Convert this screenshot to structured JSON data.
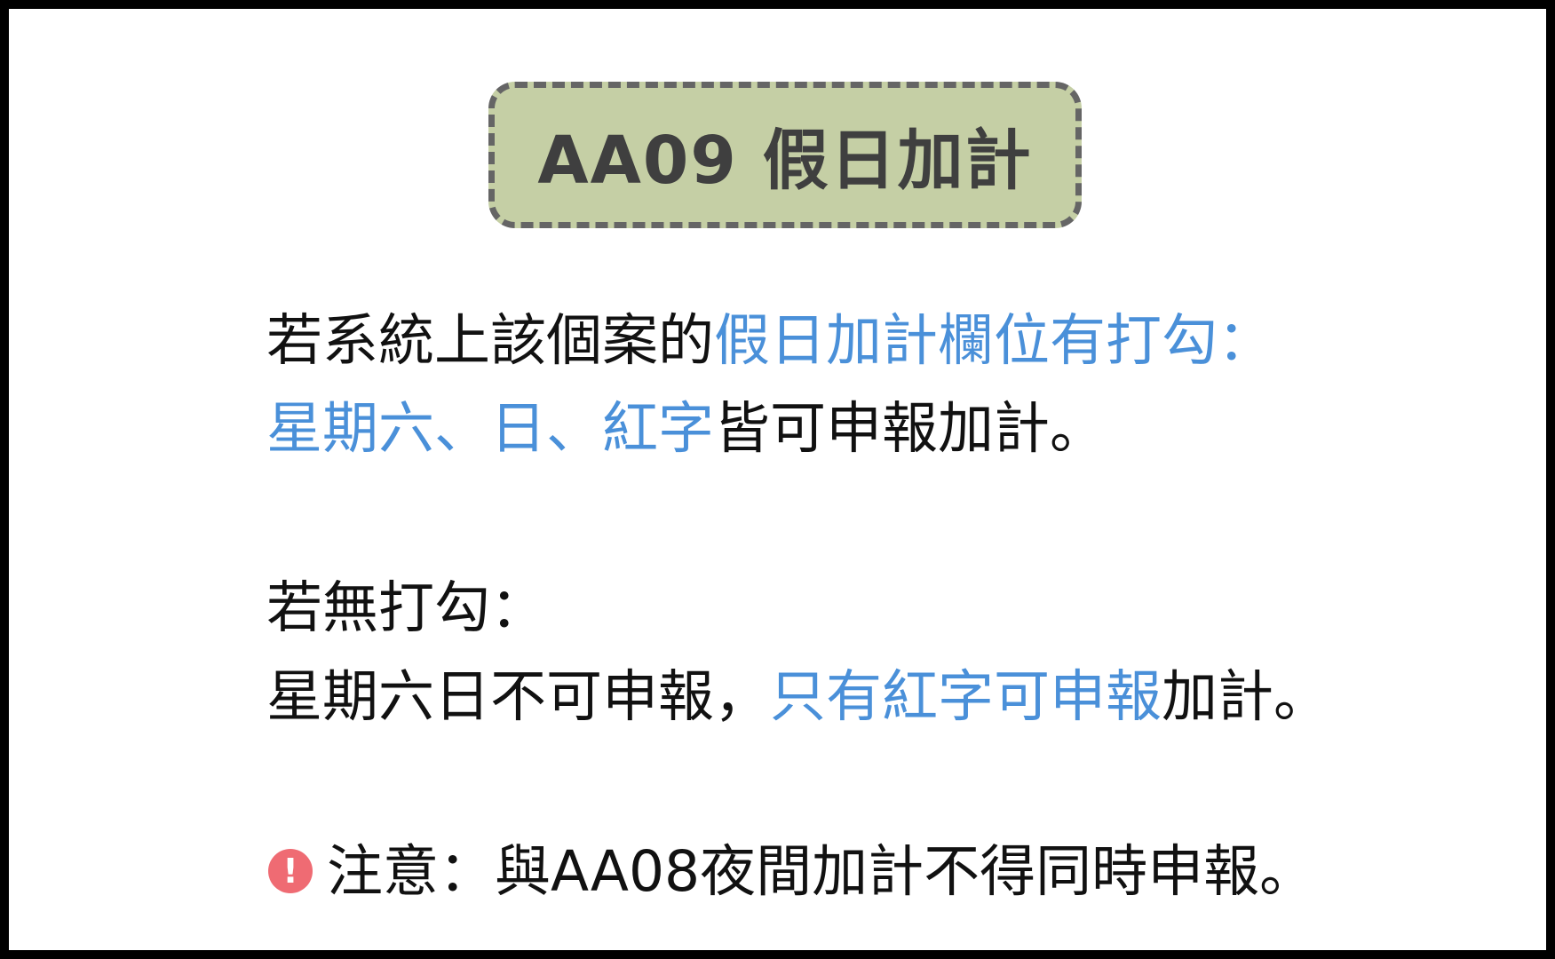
{
  "title": "AA09 假日加計",
  "paragraph1": {
    "line1_part1": "若系統上該個案的",
    "line1_highlight": "假日加計欄位有打勾：",
    "line2_highlight": "星期六、日、紅字",
    "line2_part2": "皆可申報加計。"
  },
  "paragraph2": {
    "line1": "若無打勾：",
    "line2_part1": "星期六日不可申報，",
    "line2_highlight": "只有紅字可申報",
    "line2_part2": "加計。"
  },
  "note": {
    "icon": "exclamation-icon",
    "icon_glyph": "!",
    "text": "注意：與AA08夜間加計不得同時申報。"
  },
  "colors": {
    "highlight": "#4a90d9",
    "title_bg": "#c5cfa5",
    "title_border": "#656565",
    "warning": "#ef6b73"
  }
}
